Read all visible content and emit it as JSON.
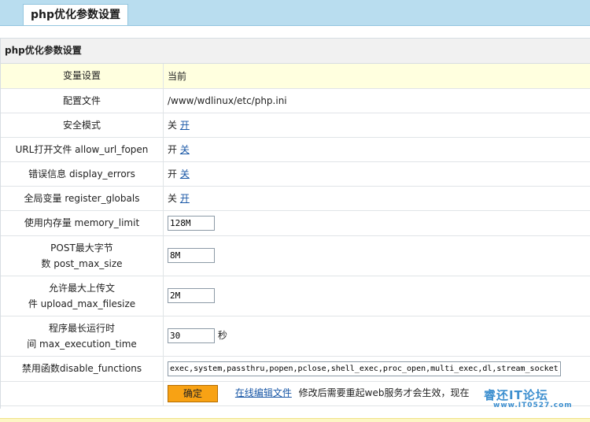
{
  "tab": {
    "label": "php优化参数设置"
  },
  "panel": {
    "title": "php优化参数设置"
  },
  "table": {
    "header": {
      "label": "变量设置",
      "value": "当前"
    },
    "config_file": {
      "label": "配置文件",
      "value": "/www/wdlinux/etc/php.ini"
    },
    "safe_mode": {
      "label": "安全模式",
      "state": "关",
      "toggle": "开"
    },
    "allow_url_fopen": {
      "label": "URL打开文件 allow_url_fopen",
      "state": "开",
      "toggle": "关"
    },
    "display_errors": {
      "label": "错误信息 display_errors",
      "state": "开",
      "toggle": "关"
    },
    "register_globals": {
      "label": "全局变量 register_globals",
      "state": "关",
      "toggle": "开"
    },
    "memory_limit": {
      "label": "使用内存量 memory_limit",
      "value": "128M"
    },
    "post_max_size": {
      "label_line1": "POST最大字节",
      "label_line2": "数 post_max_size",
      "value": "8M"
    },
    "upload_max_filesize": {
      "label_line1": "允许最大上传文",
      "label_line2": "件 upload_max_filesize",
      "value": "2M"
    },
    "max_execution_time": {
      "label_line1": "程序最长运行时",
      "label_line2": "间 max_execution_time",
      "value": "30",
      "unit": "秒"
    },
    "disable_functions": {
      "label": "禁用函数disable_functions",
      "value": "exec,system,passthru,popen,pclose,shell_exec,proc_open,multi_exec,dl,stream_socket_"
    }
  },
  "footer": {
    "confirm": "确定",
    "edit_link": "在线编辑文件",
    "note": "修改后需要重起web服务才会生效，现在"
  },
  "watermark": {
    "line1": "睿还IT论坛",
    "line2": "www.IT0527.com"
  },
  "colors": {
    "topbar": "#b9ddef",
    "header_row": "#ffffdf",
    "button": "#f8a214",
    "link": "#1957a6"
  }
}
